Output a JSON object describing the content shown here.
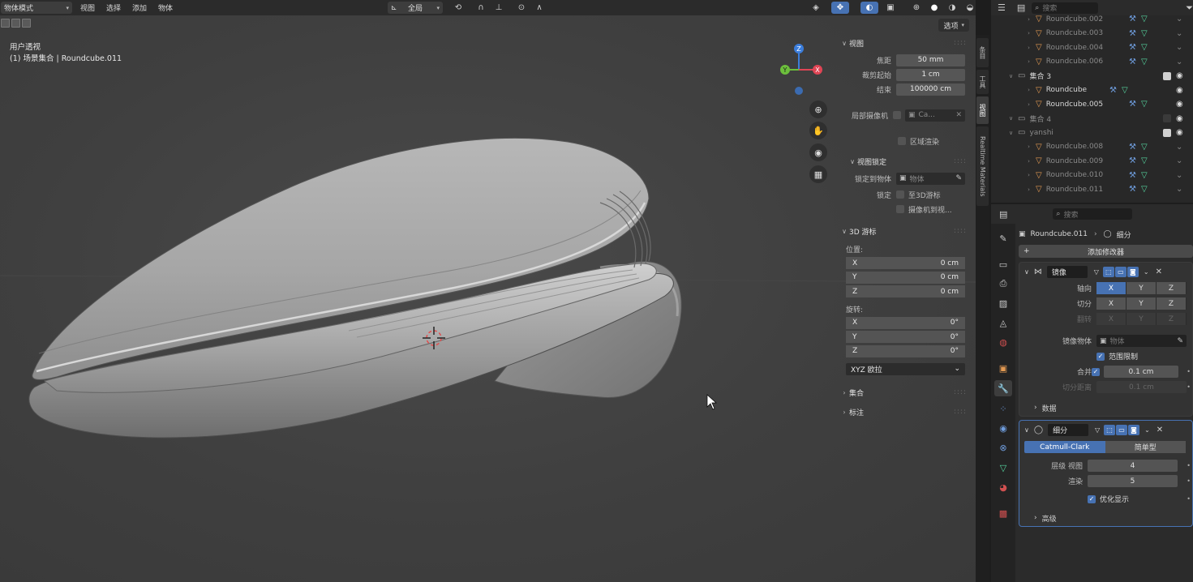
{
  "header": {
    "mode": "物体模式",
    "menus": [
      "视图",
      "选择",
      "添加",
      "物体"
    ],
    "transform_orientation": "全局"
  },
  "viewport": {
    "view_name": "用户透视",
    "collection_info": "(1) 场景集合 | Roundcube.011",
    "options_label": "选项",
    "gizmo": {
      "x": "X",
      "y": "Y",
      "z": "Z"
    }
  },
  "npanel": {
    "view_section": "视图",
    "focal_label": "焦距",
    "focal_value": "50 mm",
    "clip_start_label": "裁剪起始",
    "clip_start_value": "1 cm",
    "clip_end_label": "结束",
    "clip_end_value": "100000 cm",
    "local_camera_label": "局部摄像机",
    "local_camera_value": "Ca...",
    "region_render_label": "区域渲染",
    "view_lock_section": "视图锁定",
    "lock_to_object_label": "锁定到物体",
    "lock_to_object_placeholder": "物体",
    "lock_label": "锁定",
    "lock_3d_cursor": "至3D游标",
    "lock_camera_view": "摄像机到视...",
    "cursor_section": "3D 游标",
    "location_label": "位置:",
    "rotation_label": "旋转:",
    "loc": [
      {
        "axis": "X",
        "value": "0 cm"
      },
      {
        "axis": "Y",
        "value": "0 cm"
      },
      {
        "axis": "Z",
        "value": "0 cm"
      }
    ],
    "rot": [
      {
        "axis": "X",
        "value": "0°"
      },
      {
        "axis": "Y",
        "value": "0°"
      },
      {
        "axis": "Z",
        "value": "0°"
      }
    ],
    "rotation_mode": "XYZ 欧拉",
    "collection_section": "集合",
    "annotation_section": "标注"
  },
  "vtabs": [
    "条目",
    "工具",
    "视图",
    "Realtime Materials"
  ],
  "outliner": {
    "search_placeholder": "搜索",
    "rows": [
      {
        "name": "Roundcube.002",
        "type": "obj",
        "indent": 2,
        "hl": false
      },
      {
        "name": "Roundcube.003",
        "type": "obj",
        "indent": 2,
        "hl": false
      },
      {
        "name": "Roundcube.004",
        "type": "obj",
        "indent": 2,
        "hl": false
      },
      {
        "name": "Roundcube.006",
        "type": "obj",
        "indent": 2,
        "hl": false
      },
      {
        "name": "集合 3",
        "type": "col",
        "indent": 1,
        "hl": true
      },
      {
        "name": "Roundcube",
        "type": "obj",
        "indent": 2,
        "hl": true
      },
      {
        "name": "Roundcube.005",
        "type": "obj",
        "indent": 2,
        "hl": true
      },
      {
        "name": "集合 4",
        "type": "col",
        "indent": 1,
        "hl": false
      },
      {
        "name": "yanshi",
        "type": "col",
        "indent": 1,
        "hl": false
      },
      {
        "name": "Roundcube.008",
        "type": "obj",
        "indent": 2,
        "hl": false
      },
      {
        "name": "Roundcube.009",
        "type": "obj",
        "indent": 2,
        "hl": false
      },
      {
        "name": "Roundcube.010",
        "type": "obj",
        "indent": 2,
        "hl": false
      },
      {
        "name": "Roundcube.011",
        "type": "obj",
        "indent": 2,
        "hl": false
      }
    ]
  },
  "properties": {
    "search_placeholder": "搜索",
    "object_name": "Roundcube.011",
    "modifier_crumb": "细分",
    "add_modifier": "添加修改器",
    "mirror": {
      "name": "镜像",
      "axis_label": "轴向",
      "bisect_label": "切分",
      "flip_label": "翻转",
      "axes": [
        "X",
        "Y",
        "Z"
      ],
      "mirror_object_label": "镜像物体",
      "mirror_object_placeholder": "物体",
      "clipping_label": "范围限制",
      "merge_label": "合并",
      "merge_value": "0.1 cm",
      "bisect_distance_label": "切分距离",
      "bisect_distance_value": "0.1 cm",
      "data_label": "数据"
    },
    "subsurf": {
      "name": "细分",
      "tab_catmull": "Catmull-Clark",
      "tab_simple": "简单型",
      "levels_label": "层级 视图",
      "levels_value": "4",
      "render_label": "渲染",
      "render_value": "5",
      "optimal_label": "优化显示",
      "advanced_label": "高级"
    }
  }
}
